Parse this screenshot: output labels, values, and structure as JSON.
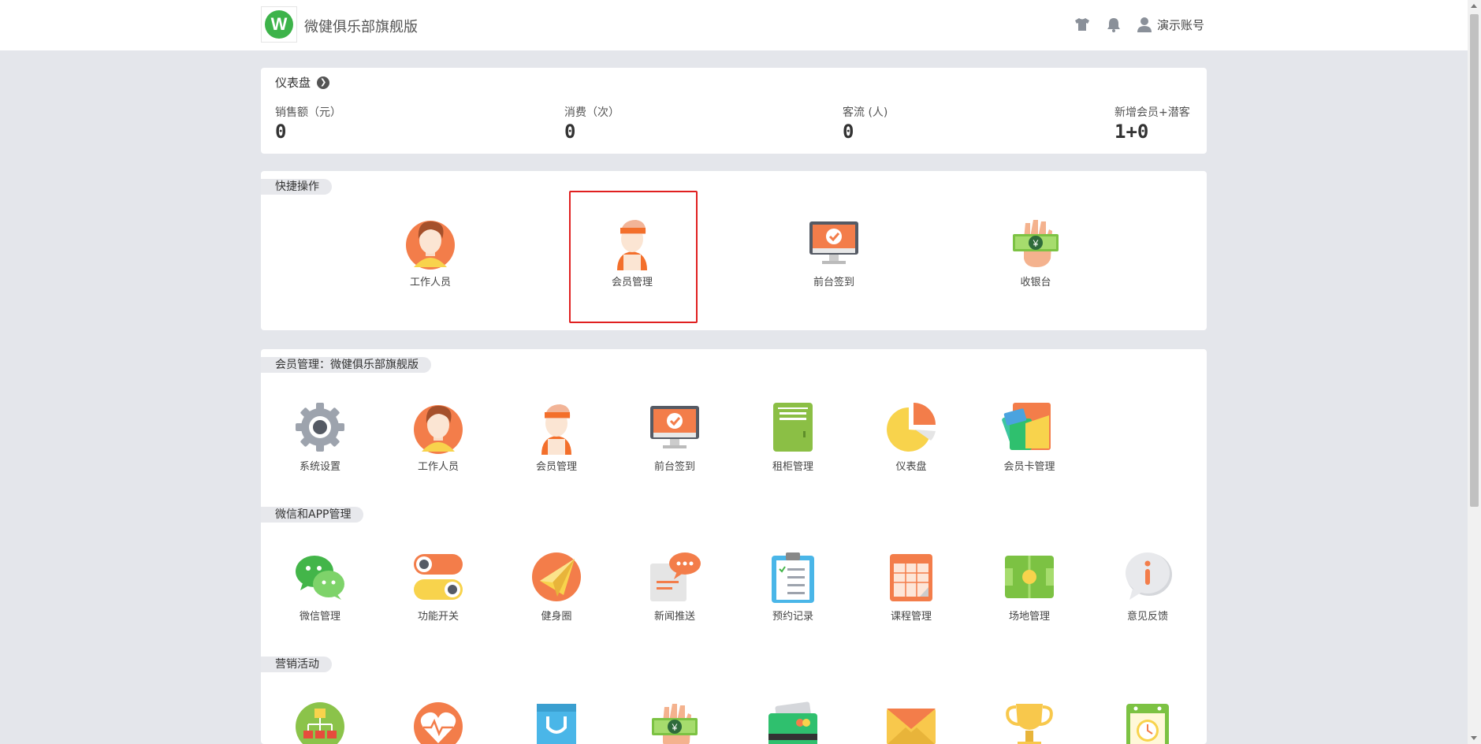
{
  "header": {
    "app_title": "微健俱乐部旗舰版",
    "logo_letter": "W",
    "account": "演示账号"
  },
  "dashboard": {
    "title": "仪表盘",
    "stats": [
      {
        "label": "销售额（元）",
        "value": "0"
      },
      {
        "label": "消费（次）",
        "value": "0"
      },
      {
        "label": "客流 (人)",
        "value": "0"
      },
      {
        "label": "新增会员+潜客",
        "value": "1+0"
      }
    ]
  },
  "quick": {
    "title": "快捷操作",
    "items": [
      {
        "label": "工作人员",
        "icon": "staff-icon"
      },
      {
        "label": "会员管理",
        "icon": "member-icon"
      },
      {
        "label": "前台签到",
        "icon": "checkin-monitor-icon"
      },
      {
        "label": "收银台",
        "icon": "cashier-icon"
      }
    ]
  },
  "member_section": {
    "title": "会员管理：微健俱乐部旗舰版",
    "items": [
      {
        "label": "系统设置",
        "icon": "gear-icon"
      },
      {
        "label": "工作人员",
        "icon": "staff-icon"
      },
      {
        "label": "会员管理",
        "icon": "member-icon"
      },
      {
        "label": "前台签到",
        "icon": "checkin-monitor-icon"
      },
      {
        "label": "租柜管理",
        "icon": "locker-icon"
      },
      {
        "label": "仪表盘",
        "icon": "pie-chart-icon"
      },
      {
        "label": "会员卡管理",
        "icon": "cards-icon"
      }
    ]
  },
  "wechat_section": {
    "title": "微信和APP管理",
    "items": [
      {
        "label": "微信管理",
        "icon": "wechat-icon"
      },
      {
        "label": "功能开关",
        "icon": "toggle-icon"
      },
      {
        "label": "健身圈",
        "icon": "paper-plane-icon"
      },
      {
        "label": "新闻推送",
        "icon": "news-chat-icon"
      },
      {
        "label": "预约记录",
        "icon": "clipboard-icon"
      },
      {
        "label": "课程管理",
        "icon": "calendar-icon"
      },
      {
        "label": "场地管理",
        "icon": "field-icon"
      },
      {
        "label": "意见反馈",
        "icon": "feedback-icon"
      }
    ]
  },
  "marketing_section": {
    "title": "营销活动",
    "items": [
      {
        "icon": "org-chart-icon"
      },
      {
        "icon": "heartbeat-icon"
      },
      {
        "icon": "shopping-bag-icon"
      },
      {
        "icon": "cashier-icon"
      },
      {
        "icon": "credit-card-icon"
      },
      {
        "icon": "envelope-icon"
      },
      {
        "icon": "trophy-icon"
      },
      {
        "icon": "clock-calendar-icon"
      }
    ]
  },
  "colors": {
    "brand": "#3db34a",
    "highlight": "#e02020",
    "background": "#e4e6eb"
  }
}
